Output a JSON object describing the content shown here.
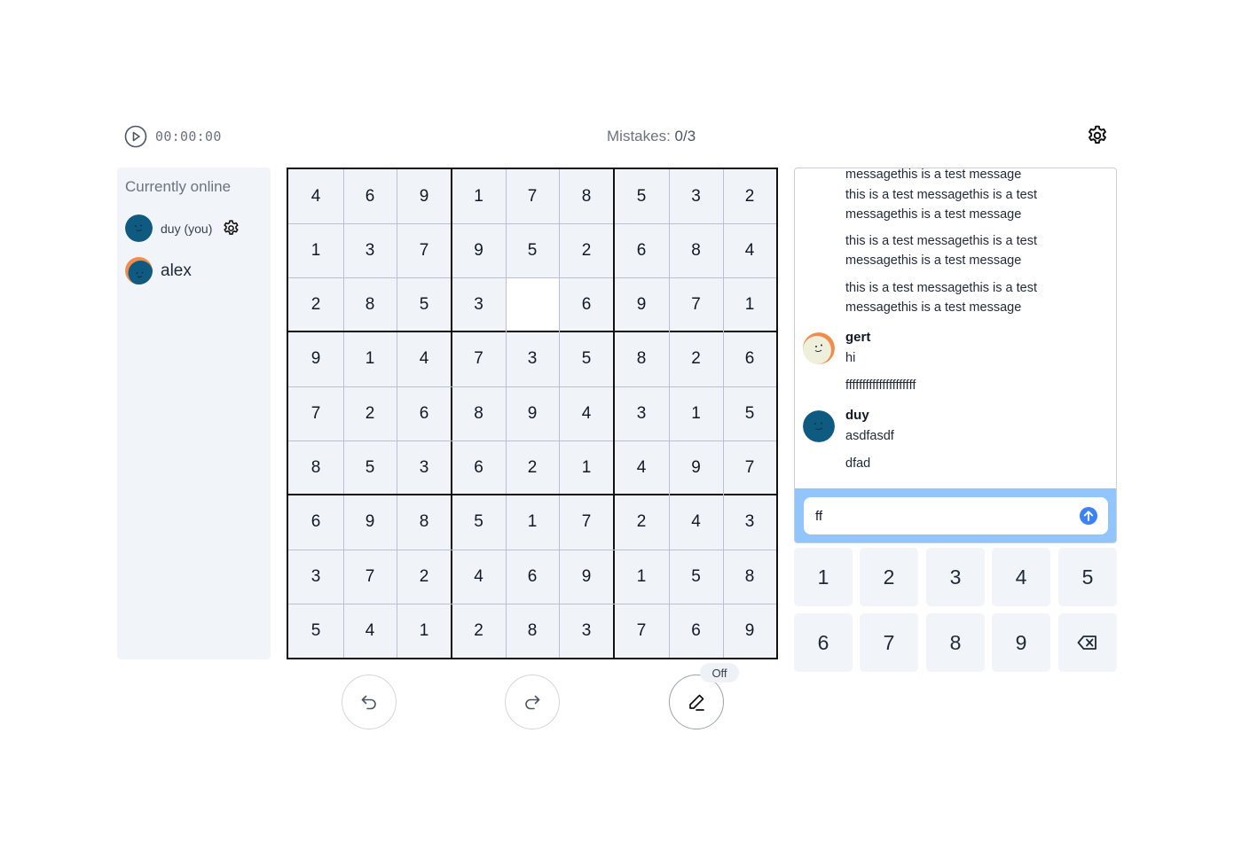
{
  "timer": {
    "text": "00:00:00"
  },
  "mistakes": {
    "label": "Mistakes: ",
    "value": "0/3"
  },
  "online": {
    "title": "Currently online",
    "users": [
      {
        "name": "duy (you)"
      },
      {
        "name": "alex"
      }
    ]
  },
  "board": {
    "rows": [
      [
        "4",
        "6",
        "9",
        "1",
        "7",
        "8",
        "5",
        "3",
        "2"
      ],
      [
        "1",
        "3",
        "7",
        "9",
        "5",
        "2",
        "6",
        "8",
        "4"
      ],
      [
        "2",
        "8",
        "5",
        "3",
        "",
        "6",
        "9",
        "7",
        "1"
      ],
      [
        "9",
        "1",
        "4",
        "7",
        "3",
        "5",
        "8",
        "2",
        "6"
      ],
      [
        "7",
        "2",
        "6",
        "8",
        "9",
        "4",
        "3",
        "1",
        "5"
      ],
      [
        "8",
        "5",
        "3",
        "6",
        "2",
        "1",
        "4",
        "9",
        "7"
      ],
      [
        "6",
        "9",
        "8",
        "5",
        "1",
        "7",
        "2",
        "4",
        "3"
      ],
      [
        "3",
        "7",
        "2",
        "4",
        "6",
        "9",
        "1",
        "5",
        "8"
      ],
      [
        "5",
        "4",
        "1",
        "2",
        "8",
        "3",
        "7",
        "6",
        "9"
      ]
    ],
    "selected_row": 2,
    "selected_col": 4
  },
  "controls": {
    "pencil_badge": "Off"
  },
  "chat": {
    "messages": [
      {
        "text": "this is a test messagethis is a test messagethis is a test message"
      },
      {
        "text": "this is a test messagethis is a test messagethis is a test message"
      },
      {
        "text": "this is a test messagethis is a test messagethis is a test message"
      },
      {
        "text": "this is a test messagethis is a test messagethis is a test message"
      }
    ],
    "groups": [
      {
        "author": "gert",
        "lines": [
          "hi",
          "fffffffffffffffffffff"
        ]
      },
      {
        "author": "duy",
        "lines": [
          "asdfasdf",
          "dfad"
        ]
      }
    ],
    "input_value": "ff"
  },
  "numpad": {
    "keys": [
      "1",
      "2",
      "3",
      "4",
      "5",
      "6",
      "7",
      "8",
      "9"
    ]
  },
  "colors": {
    "avatar_blue": "#0f5a80",
    "avatar_orange": "#f28b4b",
    "avatar_cream": "#eef0dc",
    "chat_input_bg": "#93c5fd",
    "send_blue": "#3b82f6"
  }
}
